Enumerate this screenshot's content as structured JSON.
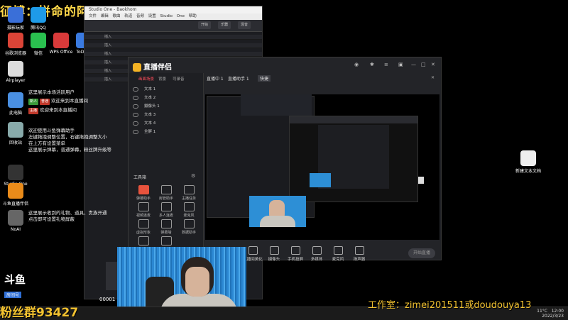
{
  "overlay": {
    "title": "征博：拼命的阿爪",
    "studio_text": "工作室：zimei201511或doudouya13",
    "room_text": "粉丝群93427",
    "douyu_logo": "斗鱼",
    "douyu_sub": "房间号",
    "left_counter": "00001"
  },
  "desktop": {
    "icons": [
      {
        "label": "摄影玩家",
        "icon": "camera-app-icon",
        "color": "#3a6fd8"
      },
      {
        "label": "腾讯QQ",
        "icon": "qq-icon",
        "color": "#1e9be8"
      },
      {
        "label": "谷歌浏览器",
        "icon": "chrome-icon",
        "color": "#db4437"
      },
      {
        "label": "微信",
        "icon": "wechat-icon",
        "color": "#2ac04f"
      },
      {
        "label": "WPS Office",
        "icon": "wps-icon",
        "color": "#d93a3a"
      },
      {
        "label": "ToDesk",
        "icon": "todesk-icon",
        "color": "#3a7ae0"
      },
      {
        "label": "Airplayer",
        "icon": "document-icon",
        "color": "#ddd"
      },
      {
        "label": "此电脑",
        "icon": "computer-icon",
        "color": "#4a90e2"
      },
      {
        "label": "回收站",
        "icon": "recycle-bin-icon",
        "color": "#8aa"
      },
      {
        "label": "Studio One",
        "icon": "studio-one-icon",
        "color": "#333"
      },
      {
        "label": "斗鱼直播伴侣",
        "icon": "help-icon",
        "color": "#e98b1a"
      },
      {
        "label": "NoAI",
        "icon": "app-icon",
        "color": "#666"
      }
    ],
    "right_icon_label": "新建文本文档"
  },
  "daw": {
    "title": "Studio One - Baokhom",
    "menu": "文件 编辑 歌曲 轨道 音频 设置 Studio One 帮助",
    "buttons": [
      "开始",
      "乐器",
      "混音"
    ],
    "tracks": [
      "插入",
      "插入",
      "插入",
      "插入",
      "插入",
      "插入"
    ]
  },
  "notices": [
    {
      "text": "这里展示本场活跃用户",
      "tags": []
    },
    {
      "text": "欢迎来到本直播间",
      "tags": [
        "新人",
        "普通"
      ]
    },
    {
      "text": "欢迎来到本直播间",
      "tags": [
        "主播"
      ]
    },
    {
      "text": "欢迎使用斗鱼弹幕助手",
      "tags": []
    },
    {
      "text": "左键拖拽调整位置，右键拖拽调整大小",
      "tags": []
    },
    {
      "text": "在上方有设置菜单",
      "tags": []
    },
    {
      "text": "这里展示弹幕，普通弹幕，粉丝牌升级等",
      "tags": []
    },
    {
      "text": "这里展示收到的礼物、道具、贵族开通",
      "tags": []
    },
    {
      "text": "点击即可设置礼物屏蔽",
      "tags": []
    }
  ],
  "app": {
    "title": "直播伴侣",
    "left_tabs": [
      "画面场景",
      "背景",
      "可录音"
    ],
    "sources": [
      "文本 1",
      "文本 2",
      "摄像头 1",
      "文本 3",
      "文本 4",
      "全屏 1"
    ],
    "tools_header": "工具箱",
    "tools": [
      "弹幕助手",
      "房管助手",
      "主播任务",
      "视频连麦",
      "多人连麦",
      "麦克风",
      "虚拟形象",
      "弹幕墙",
      "数据助手",
      "...",
      "..."
    ],
    "preview_tabs": [
      "直播中 1",
      "直播助手 1",
      "快捷"
    ],
    "bottom_buttons": [
      "直播间美化",
      "摄像头",
      "手机投屏",
      "多媒体",
      "麦克风",
      "扬声器"
    ],
    "start_live": "开始直播"
  },
  "taskbar": {
    "weather": "11°C",
    "time": "12:00",
    "date": "2022/3/23"
  }
}
